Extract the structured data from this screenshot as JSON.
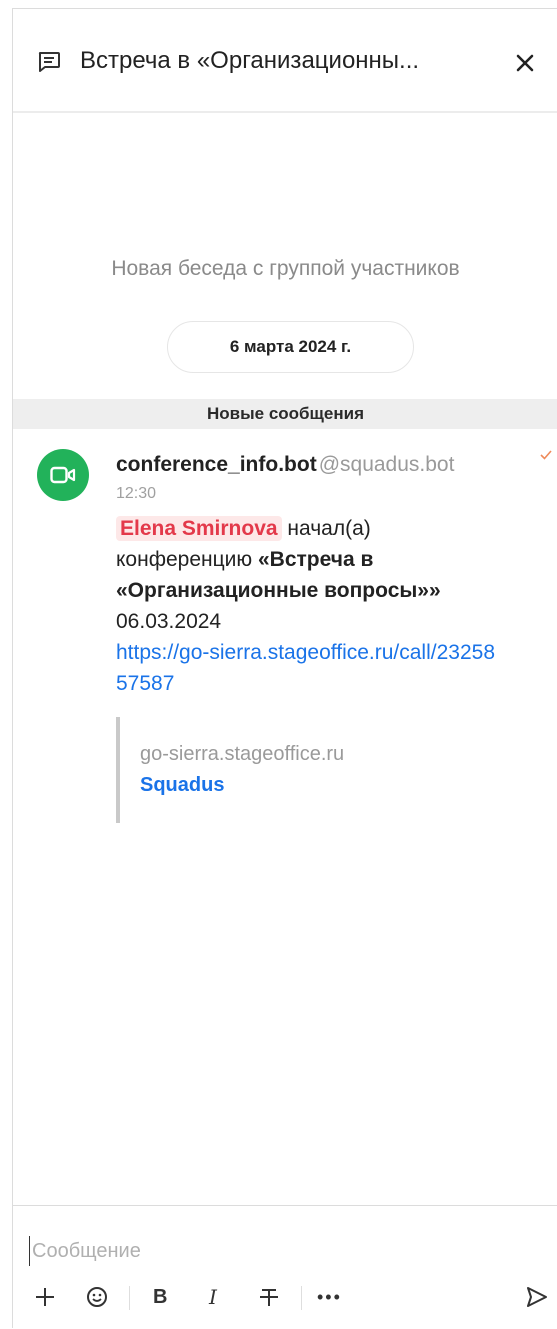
{
  "header": {
    "title": "Встреча в «Организационны...",
    "icon": "chat-icon",
    "close_icon": "close-icon"
  },
  "feed": {
    "intro_text": "Новая беседа с группой участников",
    "date_label": "6 марта 2024 г.",
    "new_messages_label": "Новые сообщения"
  },
  "message": {
    "author": "conference_info.bot",
    "handle": "@squadus.bot",
    "time": "12:30",
    "mention": "Elena Smirnova",
    "text_started": " начал(а) конференцию ",
    "conference_name": "«Встреча в «Организационные вопросы»»",
    "date": "06.03.2024",
    "link": "https://go-sierra.stageoffice.ru/call/2325857587",
    "preview_domain": "go-sierra.stageoffice.ru",
    "preview_site": "Squadus",
    "avatar_icon": "video-camera-icon",
    "status_icon": "checkmark-icon",
    "colors": {
      "avatar": "#22b25a",
      "mention_text": "#e3394a",
      "link": "#1a73e8"
    }
  },
  "composer": {
    "placeholder": "Сообщение",
    "bold_label": "B",
    "italic_label": "I",
    "more_label": "•••"
  }
}
